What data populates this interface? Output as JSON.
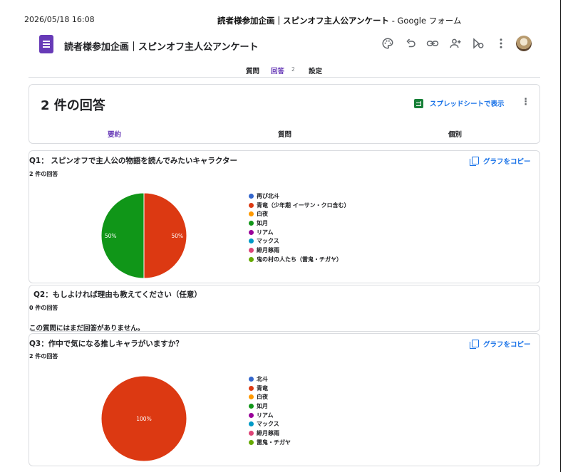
{
  "print_header": {
    "datetime": "2026/05/18 16:08",
    "title_main": "読者様参加企画｜スピンオフ主人公アンケート",
    "title_suffix": " - Google フォーム"
  },
  "app_header": {
    "form_title": "読者様参加企画｜スピンオフ主人公アンケート",
    "icons": [
      "palette-icon",
      "undo-icon",
      "link-icon",
      "add-collaborator-icon",
      "preview-icon",
      "more-vert-icon"
    ]
  },
  "tabs": {
    "questions": "質問",
    "responses": "回答",
    "responses_count": "2",
    "settings": "設定"
  },
  "summary": {
    "title": "2 件の回答",
    "sheets_label": "スプレッドシートで表示",
    "subtabs": {
      "summary": "要約",
      "question": "質問",
      "individual": "個別"
    }
  },
  "colors": {
    "accent": "#673ab7",
    "link": "#1a73e8",
    "sheets_green": "#188038"
  },
  "questions": [
    {
      "title": "Q1： スピンオフで主人公の物語を読んでみたいキャラクター",
      "count": "2 件の回答",
      "copy_label": "グラフをコピー",
      "chart_data": {
        "type": "pie",
        "categories": [
          "再び北斗",
          "青竜（少年期 イーサン・クロ含む）",
          "白夜",
          "如月",
          "リアム",
          "マックス",
          "緋月慈雨",
          "鬼の村の人たち（雷鬼・チガヤ）"
        ],
        "colors": [
          "#3366cc",
          "#dc3912",
          "#ff9900",
          "#109618",
          "#990099",
          "#0099c6",
          "#dd4477",
          "#66aa00"
        ],
        "values": [
          0,
          1,
          0,
          1,
          0,
          0,
          0,
          0
        ],
        "labels": [
          "",
          "50%",
          "",
          "50%",
          "",
          "",
          "",
          ""
        ]
      }
    },
    {
      "title": "Q2：もしよければ理由も教えてください（任意）",
      "count": "0 件の回答",
      "empty_message": "この質問にはまだ回答がありません。"
    },
    {
      "title": "Q3：作中で気になる推しキャラがいますか？",
      "count": "2 件の回答",
      "copy_label": "グラフをコピー",
      "chart_data": {
        "type": "pie",
        "categories": [
          "北斗",
          "青竜",
          "白夜",
          "如月",
          "リアム",
          "マックス",
          "緋月慈雨",
          "雷鬼・チガヤ"
        ],
        "colors": [
          "#3366cc",
          "#dc3912",
          "#ff9900",
          "#109618",
          "#990099",
          "#0099c6",
          "#dd4477",
          "#66aa00"
        ],
        "values": [
          0,
          2,
          0,
          0,
          0,
          0,
          0,
          0
        ],
        "labels": [
          "",
          "100%",
          "",
          "",
          "",
          "",
          "",
          ""
        ]
      }
    }
  ]
}
